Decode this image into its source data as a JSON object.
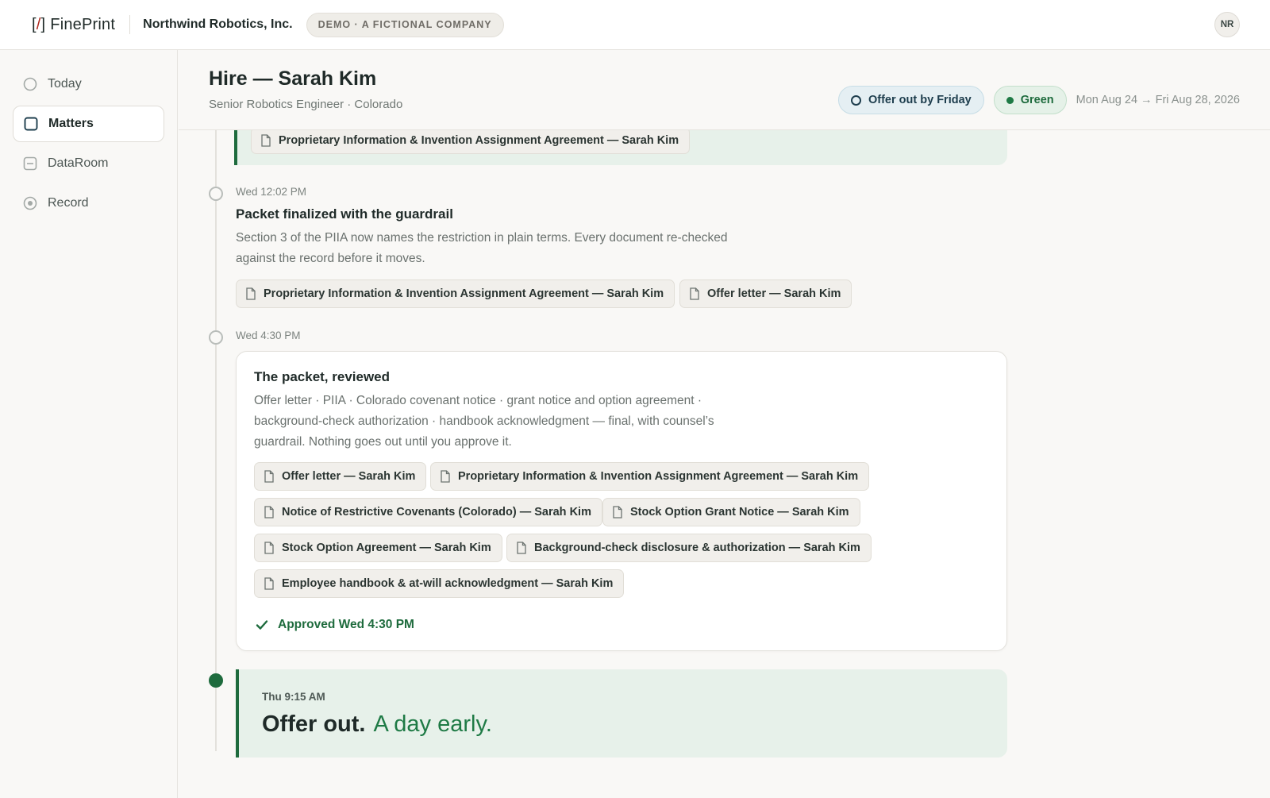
{
  "topbar": {
    "logo_mark_left": "[",
    "logo_mark_slash": "/",
    "logo_mark_right": "]",
    "logo_text": "FinePrint",
    "company": "Northwind Robotics, Inc.",
    "demo_badge": "DEMO · A FICTIONAL COMPANY",
    "avatar_initials": "NR"
  },
  "sidebar": {
    "items": [
      {
        "label": "Today",
        "icon": "circle-icon",
        "active": false
      },
      {
        "label": "Matters",
        "icon": "square-icon",
        "active": true
      },
      {
        "label": "DataRoom",
        "icon": "dataroom-icon",
        "active": false
      },
      {
        "label": "Record",
        "icon": "record-icon",
        "active": false
      }
    ]
  },
  "header": {
    "title": "Hire — Sarah Kim",
    "subtitle": "Senior Robotics Engineer · Colorado",
    "deadline_pill": "Offer out by Friday",
    "status_pill": "Green",
    "date_range": "Mon Aug 24 → Fri Aug 28, 2026"
  },
  "timeline": {
    "top_card": {
      "chip": "Proprietary Information & Invention Assignment Agreement — Sarah Kim"
    },
    "event1": {
      "time": "Wed 12:02 PM",
      "title": "Packet finalized with the guardrail",
      "body_line1": "Section 3 of the PIIA now names the restriction in plain terms. Every document re-checked",
      "body_line2": "against the record before it moves.",
      "chips": [
        "Proprietary Information & Invention Assignment Agreement — Sarah Kim",
        "Offer letter — Sarah Kim"
      ]
    },
    "event2": {
      "time": "Wed 4:30 PM",
      "title": "The packet, reviewed",
      "body_line1": "Offer letter · PIIA · Colorado covenant notice · grant notice and option agreement ·",
      "body_line2": "background-check authorization · handbook acknowledgment — final, with counsel’s",
      "body_line3": "guardrail. Nothing goes out until you approve it.",
      "chips": [
        "Offer letter — Sarah Kim",
        "Proprietary Information & Invention Assignment Agreement — Sarah Kim",
        "Notice of Restrictive Covenants (Colorado) — Sarah Kim",
        "Stock Option Grant Notice — Sarah Kim",
        "Stock Option Agreement — Sarah Kim",
        "Background-check disclosure & authorization — Sarah Kim",
        "Employee handbook & at-will acknowledgment — Sarah Kim"
      ],
      "approved": "Approved Wed 4:30 PM"
    },
    "event3": {
      "time": "Thu 9:15 AM",
      "headline_strong": "Offer out.",
      "headline_soft": "A day early."
    }
  },
  "colors": {
    "accent_green": "#1e6b3d",
    "logo_slash_red": "#b0291f",
    "deadline_blue": "#1d3d4d"
  }
}
